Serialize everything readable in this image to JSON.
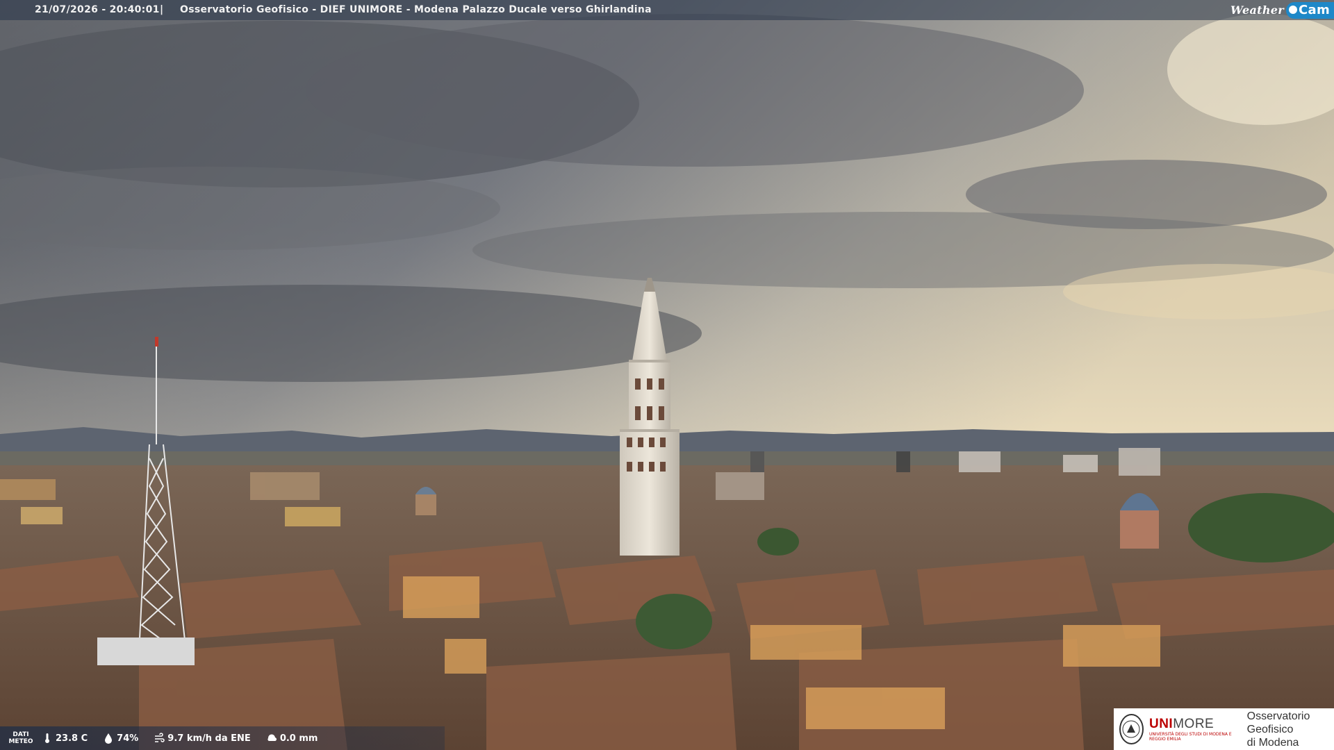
{
  "overlay": {
    "timestamp": "21/07/2026 - 20:40:01",
    "separator": "|",
    "caption": "Osservatorio Geofisico - DIEF UNIMORE - Modena Palazzo Ducale verso Ghirlandina",
    "brand_weather": "Weather",
    "brand_cam": "Cam"
  },
  "meteo": {
    "label": "DATI METEO",
    "temperature": "23.8 C",
    "humidity": "74%",
    "wind": "9.7 km/h da ENE",
    "rain": "0.0 mm"
  },
  "logo": {
    "university_main": "UNI",
    "university_more": "MORE",
    "university_sub": "UNIVERSITÀ DEGLI STUDI DI MODENA E REGGIO EMILIA",
    "observatory_line1": "Osservatorio Geofisico",
    "observatory_line2": "di Modena"
  },
  "icons": {
    "temperature": "thermometer-icon",
    "humidity": "droplet-icon",
    "wind": "wind-icon",
    "rain": "rain-icon",
    "camera": "camera-icon"
  }
}
